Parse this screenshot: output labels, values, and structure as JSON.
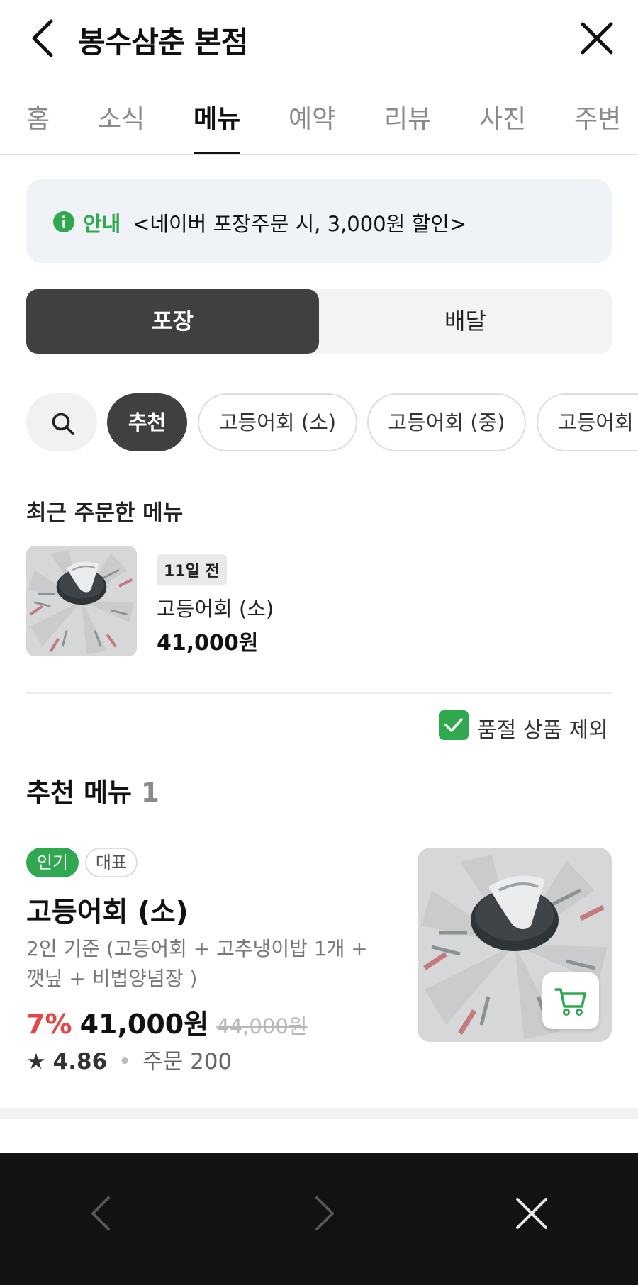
{
  "header": {
    "title": "봉수삼춘 본점"
  },
  "tabs": [
    {
      "label": "홈",
      "active": false
    },
    {
      "label": "소식",
      "active": false
    },
    {
      "label": "메뉴",
      "active": true
    },
    {
      "label": "예약",
      "active": false
    },
    {
      "label": "리뷰",
      "active": false
    },
    {
      "label": "사진",
      "active": false
    },
    {
      "label": "주변",
      "active": false
    }
  ],
  "notice": {
    "label": "안내",
    "text": "<네이버 포장주문 시, 3,000원 할인>"
  },
  "order_type": {
    "options": [
      "포장",
      "배달"
    ],
    "selected": "포장"
  },
  "chips": [
    "추천",
    "고등어회 (소)",
    "고등어회 (중)",
    "고등어회"
  ],
  "recent": {
    "title": "최근 주문한 메뉴",
    "badge": "11일 전",
    "name": "고등어회 (소)",
    "price": "41,000원"
  },
  "soldout_filter": {
    "label": "품절 상품 제외",
    "checked": true
  },
  "recommended": {
    "title": "추천 메뉴",
    "count": "1",
    "item": {
      "tags": [
        "인기",
        "대표"
      ],
      "name": "고등어회 (소)",
      "description": "2인 기준 (고등어회 + 고추냉이밥 1개 + 깻닢 + 비법양념장 )",
      "discount": "7%",
      "price": "41,000원",
      "original_price": "44,000원",
      "rating": "4.86",
      "orders": "주문 200"
    }
  },
  "colors": {
    "accent_green": "#2fa84f",
    "discount_red": "#e04848",
    "dark": "#404040"
  },
  "icons": [
    "back-icon",
    "close-icon",
    "info-icon",
    "search-icon",
    "check-icon",
    "star-icon",
    "cart-icon",
    "browser-back-icon",
    "browser-forward-icon",
    "browser-close-icon"
  ]
}
